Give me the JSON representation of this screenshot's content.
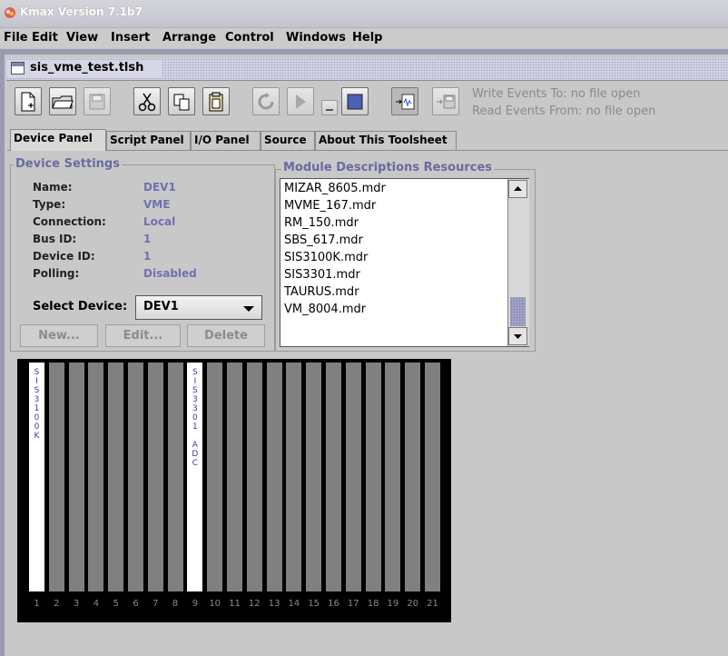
{
  "window": {
    "title": "Kmax Version 7.1b7"
  },
  "menu": [
    "File",
    "Edit",
    "View",
    "Insert",
    "Arrange",
    "Control",
    "Windows",
    "Help"
  ],
  "document": {
    "title": "sis_vme_test.tlsh"
  },
  "toolbar": {
    "buttons": [
      {
        "name": "new-document-icon"
      },
      {
        "name": "open-folder-icon"
      },
      {
        "name": "save-icon"
      },
      {
        "name": "cut-icon"
      },
      {
        "name": "copy-icon"
      },
      {
        "name": "paste-icon"
      },
      {
        "name": "refresh-icon"
      },
      {
        "name": "play-icon"
      },
      {
        "name": "pause-icon"
      },
      {
        "name": "stop-icon"
      },
      {
        "name": "read-events-icon"
      },
      {
        "name": "write-events-icon"
      }
    ],
    "write_events": "Write Events To: no file open",
    "read_events": "Read Events From: no file open"
  },
  "tabs": [
    "Device Panel",
    "Script Panel",
    "I/O Panel",
    "Source",
    "About This Toolsheet"
  ],
  "active_tab": "Device Panel",
  "device_settings": {
    "title": "Device Settings",
    "fields": [
      {
        "label": "Name:",
        "value": "DEV1"
      },
      {
        "label": "Type:",
        "value": "VME"
      },
      {
        "label": "Connection:",
        "value": "Local"
      },
      {
        "label": "Bus ID:",
        "value": "1"
      },
      {
        "label": "Device ID:",
        "value": "1"
      },
      {
        "label": "Polling:",
        "value": "Disabled"
      }
    ],
    "select_label": "Select Device:",
    "select_value": "DEV1",
    "buttons": [
      "New...",
      "Edit...",
      "Delete"
    ]
  },
  "module_resources": {
    "title": "Module Descriptions Resources",
    "items": [
      "MIZAR_8605.mdr",
      "MVME_167.mdr",
      "RM_150.mdr",
      "SBS_617.mdr",
      "SIS3100K.mdr",
      "SIS3301.mdr",
      "TAURUS.mdr",
      "VM_8004.mdr"
    ]
  },
  "crate": {
    "slot_numbers": [
      "1",
      "2",
      "3",
      "4",
      "5",
      "6",
      "7",
      "8",
      "9",
      "10",
      "11",
      "12",
      "13",
      "14",
      "15",
      "16",
      "17",
      "18",
      "19",
      "20",
      "21"
    ],
    "modules": [
      {
        "slot": "1",
        "label": "SIS3100K"
      },
      {
        "slot": "9",
        "label": "SIS3301 ADC"
      }
    ]
  },
  "colors": {
    "label_blue": "#7070b0",
    "group_title": "#6a6aa0",
    "crate_bg": "#000000",
    "empty_slot": "#808080",
    "module_text": "#3a3aa0"
  }
}
